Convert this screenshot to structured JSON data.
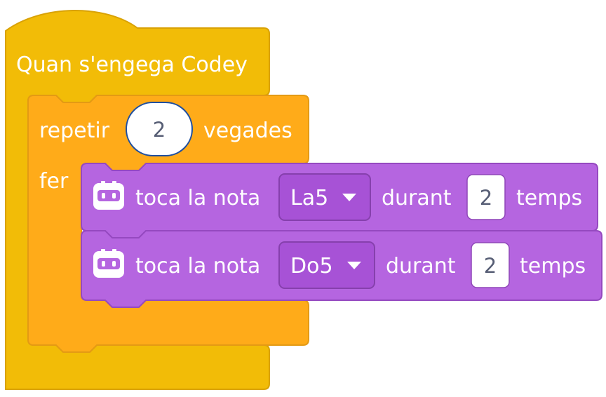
{
  "colors": {
    "hat_block": "#f2bc07",
    "control_block": "#ffab19",
    "sound_block": "#b565e0",
    "dropdown": "#a752d6",
    "text_on_block": "#ffffff",
    "input_text": "#575e75"
  },
  "hat_block": {
    "label": "Quan s'engega Codey"
  },
  "repeat_block": {
    "label_prefix": "repetir",
    "count_value": "2",
    "label_suffix": "vegades",
    "do_label": "fer"
  },
  "note_blocks": [
    {
      "icon": "codey-robot-icon",
      "label": "toca la nota",
      "note_value": "La5",
      "during_label": "durant",
      "beats_value": "2",
      "unit_label": "temps"
    },
    {
      "icon": "codey-robot-icon",
      "label": "toca la nota",
      "note_value": "Do5",
      "during_label": "durant",
      "beats_value": "2",
      "unit_label": "temps"
    }
  ]
}
